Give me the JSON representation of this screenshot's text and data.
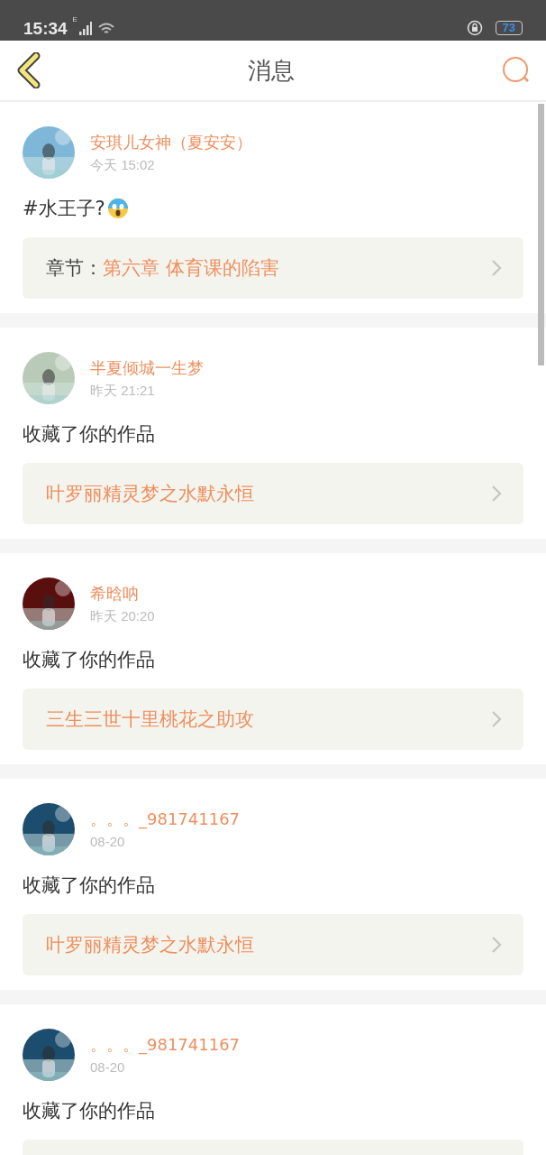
{
  "status_bar": {
    "time": "15:34",
    "network": "E",
    "battery": "73"
  },
  "header": {
    "title": "消息"
  },
  "messages": [
    {
      "user": "安琪儿女神（夏安安）",
      "time": "今天 15:02",
      "text": "#水王子?",
      "emoji": true,
      "link": {
        "label": "章节：",
        "title": "第六章 体育课的陷害"
      }
    },
    {
      "user": "半夏倾城一生梦",
      "time": "昨天 21:21",
      "text": "收藏了你的作品",
      "emoji": false,
      "link": {
        "title": "叶罗丽精灵梦之水默永恒"
      }
    },
    {
      "user": "希晗呐",
      "time": "昨天 20:20",
      "text": "收藏了你的作品",
      "emoji": false,
      "link": {
        "title": "三生三世十里桃花之助攻"
      }
    },
    {
      "user": "。。。_981741167",
      "time": "08-20",
      "text": "收藏了你的作品",
      "emoji": false,
      "link": {
        "title": "叶罗丽精灵梦之水默永恒"
      }
    },
    {
      "user": "。。。_981741167",
      "time": "08-20",
      "text": "收藏了你的作品",
      "emoji": false
    }
  ]
}
